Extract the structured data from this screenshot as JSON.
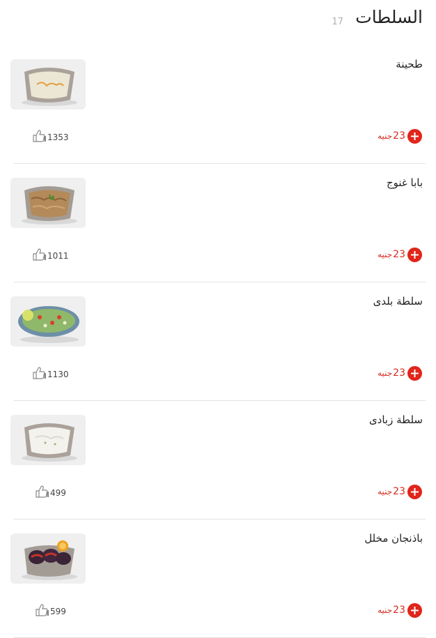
{
  "header": {
    "title": "السلطات",
    "count": "17"
  },
  "items": [
    {
      "name": "طحينة",
      "price": "23",
      "currency": "جنيه",
      "likes": "1353",
      "image": "tahini"
    },
    {
      "name": "بابا غنوج",
      "price": "23",
      "currency": "جنيه",
      "likes": "1011",
      "image": "baba-ghanoush"
    },
    {
      "name": "سلطة بلدى",
      "price": "23",
      "currency": "جنيه",
      "likes": "1130",
      "image": "baladi-salad"
    },
    {
      "name": "سلطة زبادى",
      "price": "23",
      "currency": "جنيه",
      "likes": "499",
      "image": "yogurt-salad"
    },
    {
      "name": "باذنجان مخلل",
      "price": "23",
      "currency": "جنيه",
      "likes": "599",
      "image": "pickled-eggplant"
    }
  ],
  "colors": {
    "accent": "#e1251b",
    "price_text": "#d52b1e",
    "divider": "#e2e2e2",
    "muted": "#b0b0b0"
  },
  "icons": {
    "add": "plus-circle-icon",
    "like": "thumbs-up-icon"
  }
}
